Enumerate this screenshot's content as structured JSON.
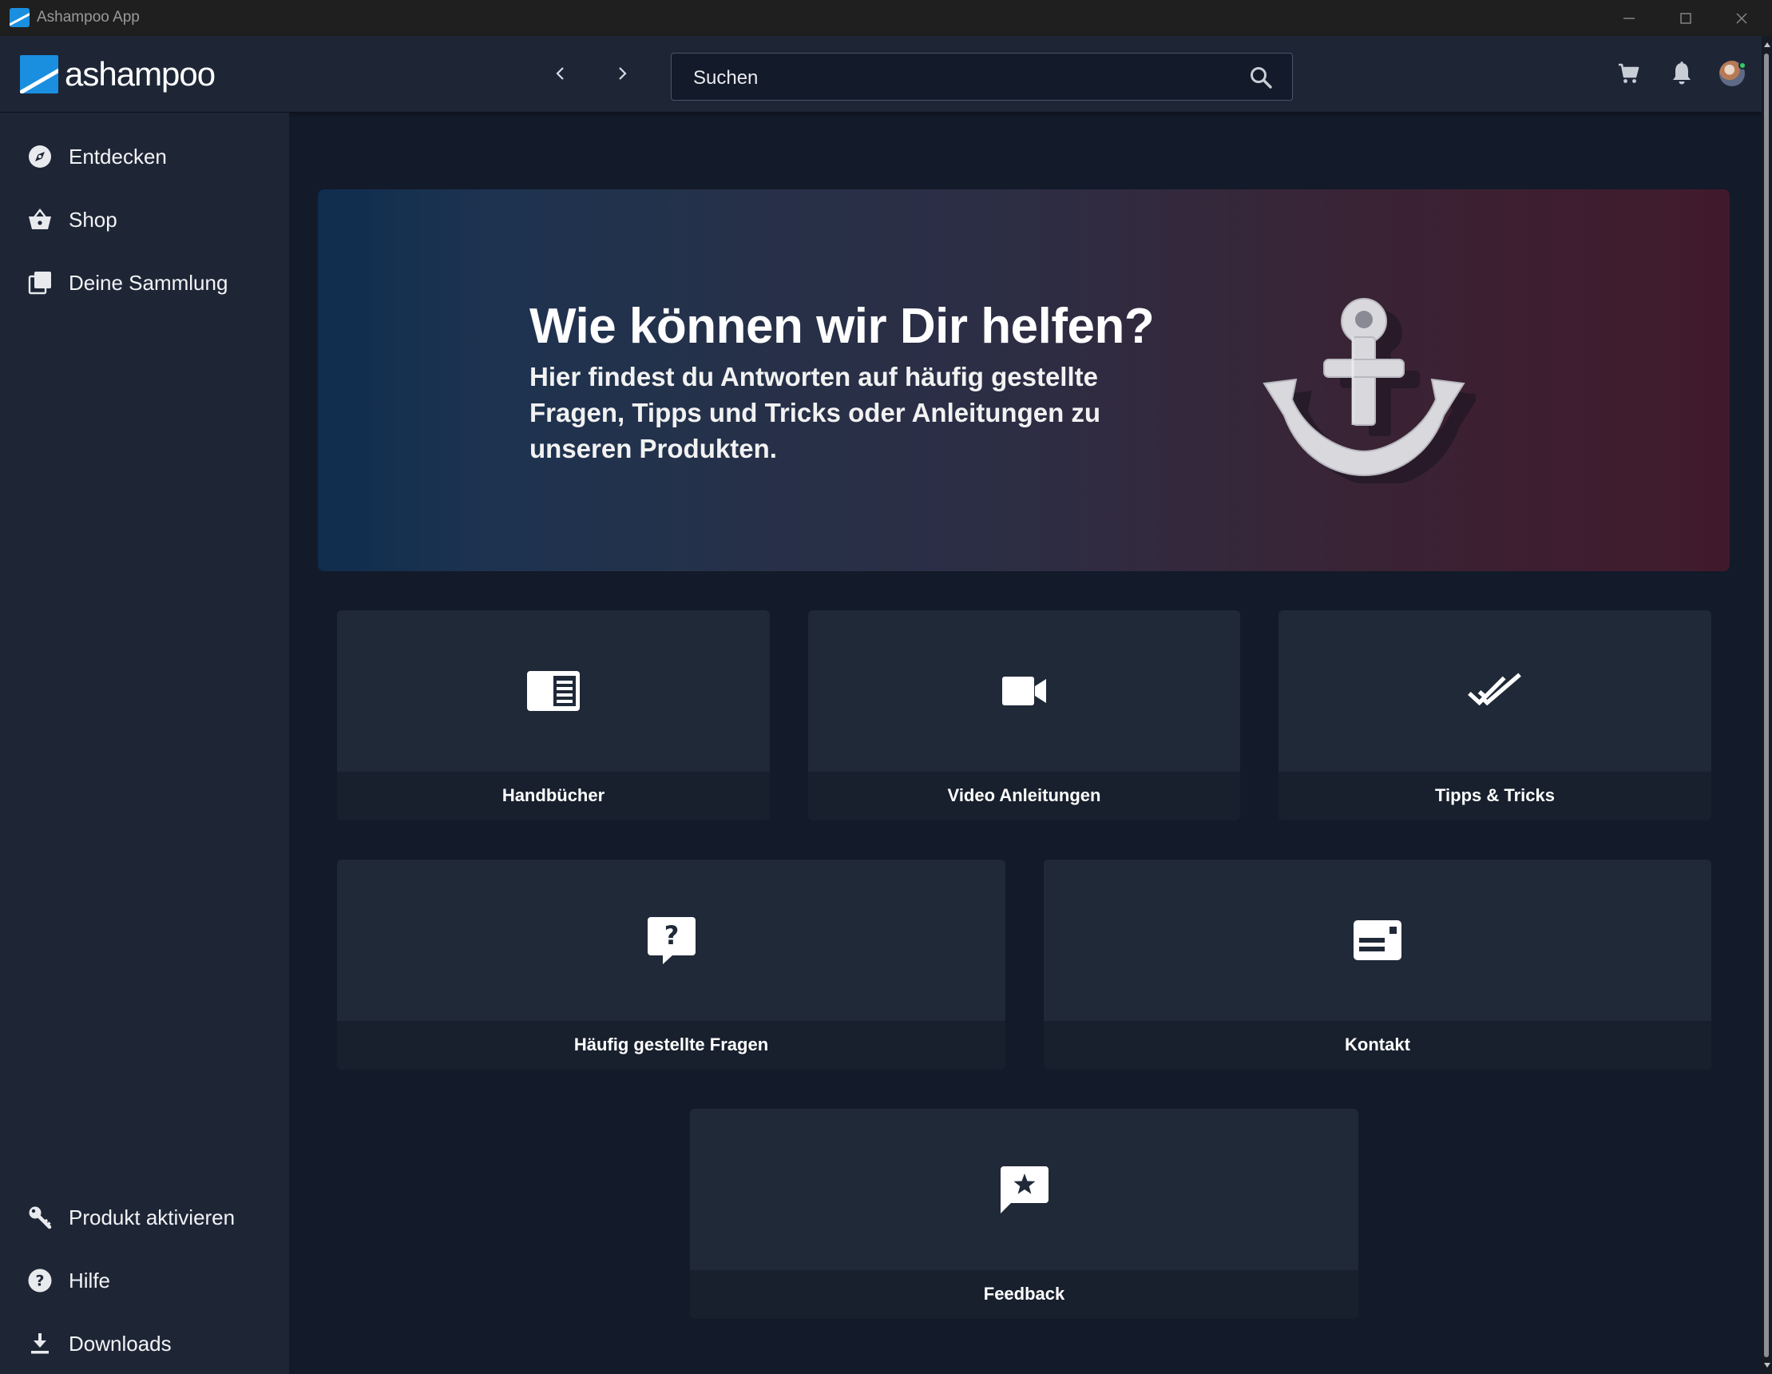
{
  "window": {
    "title": "Ashampoo App"
  },
  "header": {
    "logo_text": "ashampoo",
    "search": {
      "placeholder": "Suchen"
    }
  },
  "sidebar": {
    "top_items": [
      {
        "label": "Entdecken",
        "icon": "compass-icon"
      },
      {
        "label": "Shop",
        "icon": "basket-icon"
      },
      {
        "label": "Deine Sammlung",
        "icon": "collection-icon"
      }
    ],
    "bottom_items": [
      {
        "label": "Produkt aktivieren",
        "icon": "key-icon"
      },
      {
        "label": "Hilfe",
        "icon": "help-icon"
      },
      {
        "label": "Downloads",
        "icon": "download-icon"
      }
    ]
  },
  "hero": {
    "title": "Wie können wir Dir helfen?",
    "subtitle": "Hier findest du Antworten auf häufig gestellte Fragen, Tipps und Tricks oder Anleitungen zu unseren Produkten.",
    "image": "anchor-illustration"
  },
  "cards": [
    {
      "label": "Handbücher",
      "icon": "manual-icon"
    },
    {
      "label": "Video Anleitungen",
      "icon": "video-camera-icon"
    },
    {
      "label": "Tipps & Tricks",
      "icon": "double-check-icon"
    },
    {
      "label": "Häufig gestellte Fragen",
      "icon": "question-bubble-icon"
    },
    {
      "label": "Kontakt",
      "icon": "contact-card-icon"
    },
    {
      "label": "Feedback",
      "icon": "star-bubble-icon"
    }
  ],
  "colors": {
    "background": "#131a29",
    "panel": "#1e2636",
    "card": "#202938",
    "accent": "#1a8fe0",
    "online": "#33cc66"
  }
}
